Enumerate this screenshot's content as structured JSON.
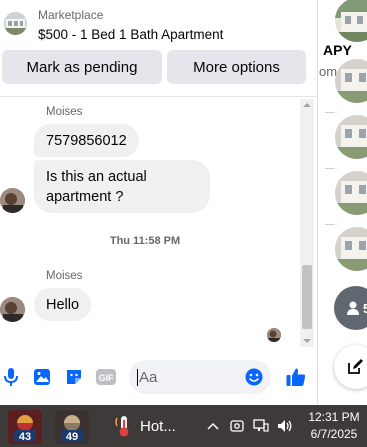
{
  "header": {
    "subtitle": "Marketplace",
    "title": "$500 - 1 Bed 1 Bath Apartment",
    "actions": {
      "pending_label": "Mark as pending",
      "more_label": "More options"
    }
  },
  "messages": {
    "group1": {
      "sender": "Moises",
      "bubbles": [
        "7579856012",
        "Is this an actual apartment ?"
      ]
    },
    "timestamp": "Thu 11:58 PM",
    "group2": {
      "sender": "Moises",
      "bubbles": [
        "Hello"
      ]
    }
  },
  "composer": {
    "placeholder": "Aa",
    "icons": [
      "microphone-icon",
      "photo-icon",
      "sticker-icon",
      "gif-icon",
      "emoji-icon",
      "thumbs-up-icon"
    ],
    "gif_label": "GIF"
  },
  "sidebar": {
    "label": "APY",
    "sublabel": "om",
    "new_chat_glyph": "5"
  },
  "taskbar": {
    "weather1": "43",
    "weather2": "49",
    "app_label": "Hot...",
    "time": "12:31 PM",
    "date": "6/7/2025"
  },
  "colors": {
    "accent": "#0866ff",
    "bubble": "#f0f0f0",
    "taskbar": "#3e3a3a"
  }
}
